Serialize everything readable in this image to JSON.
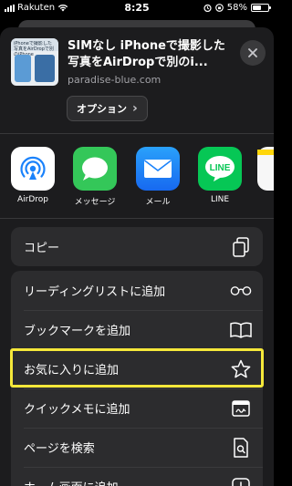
{
  "status_bar": {
    "carrier": "Rakuten",
    "time": "8:25",
    "battery_percent": "58%",
    "battery_level": 0.58
  },
  "share_header": {
    "title": "SIMなし iPhoneで撮影した写真をAirDropで別のi...",
    "domain": "paradise-blue.com",
    "options_label": "オプション",
    "options_chevron": "›",
    "thumbnail_text": "iPhoneで撮影した写真をAirDropで別のiPhone"
  },
  "apps": [
    {
      "label": "AirDrop",
      "icon": "airdrop-icon",
      "color": "#ffffff"
    },
    {
      "label": "メッセージ",
      "icon": "messages-icon",
      "color": "#34c759"
    },
    {
      "label": "メール",
      "icon": "mail-icon",
      "color": "#1a82fb"
    },
    {
      "label": "LINE",
      "icon": "line-icon",
      "color": "#06c755"
    }
  ],
  "actions_group1": [
    {
      "label": "コピー",
      "icon": "copy-icon"
    }
  ],
  "actions_group2": [
    {
      "label": "リーディングリストに追加",
      "icon": "glasses-icon"
    },
    {
      "label": "ブックマークを追加",
      "icon": "book-icon"
    },
    {
      "label": "お気に入りに追加",
      "icon": "star-icon"
    },
    {
      "label": "クイックメモに追加",
      "icon": "quick-note-icon"
    },
    {
      "label": "ページを検索",
      "icon": "find-on-page-icon"
    },
    {
      "label": "ホーム画面に追加",
      "icon": "add-to-home-icon"
    }
  ],
  "colors": {
    "sheet_bg": "#1c1c1e",
    "group_bg": "#2c2c2e",
    "highlight": "#f5e83a"
  }
}
